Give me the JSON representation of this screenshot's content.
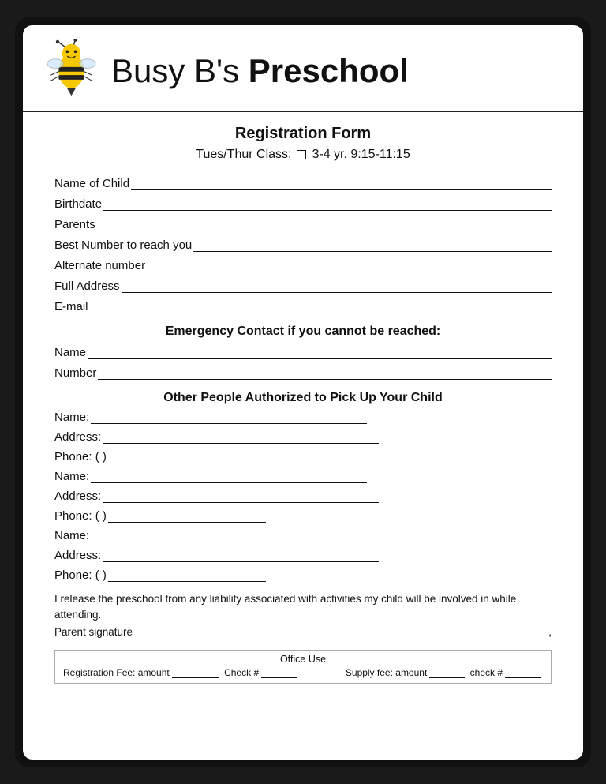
{
  "header": {
    "title_normal": "Busy B's ",
    "title_bold": "Preschool"
  },
  "form": {
    "title": "Registration Form",
    "class_info_prefix": "Tues/Thur Class:",
    "class_info_suffix": "3-4 yr. 9:15-11:15",
    "fields": [
      {
        "label": "Name of Child"
      },
      {
        "label": "Birthdate"
      },
      {
        "label": "Parents"
      },
      {
        "label": "Best Number to reach you"
      },
      {
        "label": "Alternate number"
      },
      {
        "label": "Full Address"
      },
      {
        "label": "E-mail"
      }
    ],
    "emergency_heading": "Emergency Contact if you cannot be reached:",
    "emergency_fields": [
      {
        "label": "Name"
      },
      {
        "label": "Number"
      }
    ],
    "authorized_heading": "Other People Authorized to Pick Up Your Child",
    "authorized_groups": [
      [
        {
          "label": "Name:",
          "type": "medium"
        },
        {
          "label": "Address:",
          "type": "medium"
        },
        {
          "label": "Phone: (   )",
          "type": "short"
        }
      ],
      [
        {
          "label": "Name:",
          "type": "medium"
        },
        {
          "label": "Address:",
          "type": "medium"
        },
        {
          "label": "Phone: (   )",
          "type": "short"
        }
      ],
      [
        {
          "label": "Name:",
          "type": "medium"
        },
        {
          "label": "Address:",
          "type": "medium"
        },
        {
          "label": "Phone: (   )",
          "type": "short"
        }
      ]
    ],
    "liability_text": "I release the preschool from any liability associated with activities my child will be involved in while attending.",
    "signature_label": "Parent signature",
    "office_use": {
      "title": "Office Use",
      "left": "Registration Fee: amount",
      "left_field": "Check #",
      "right": "Supply fee: amount",
      "right_field": "check #"
    }
  }
}
